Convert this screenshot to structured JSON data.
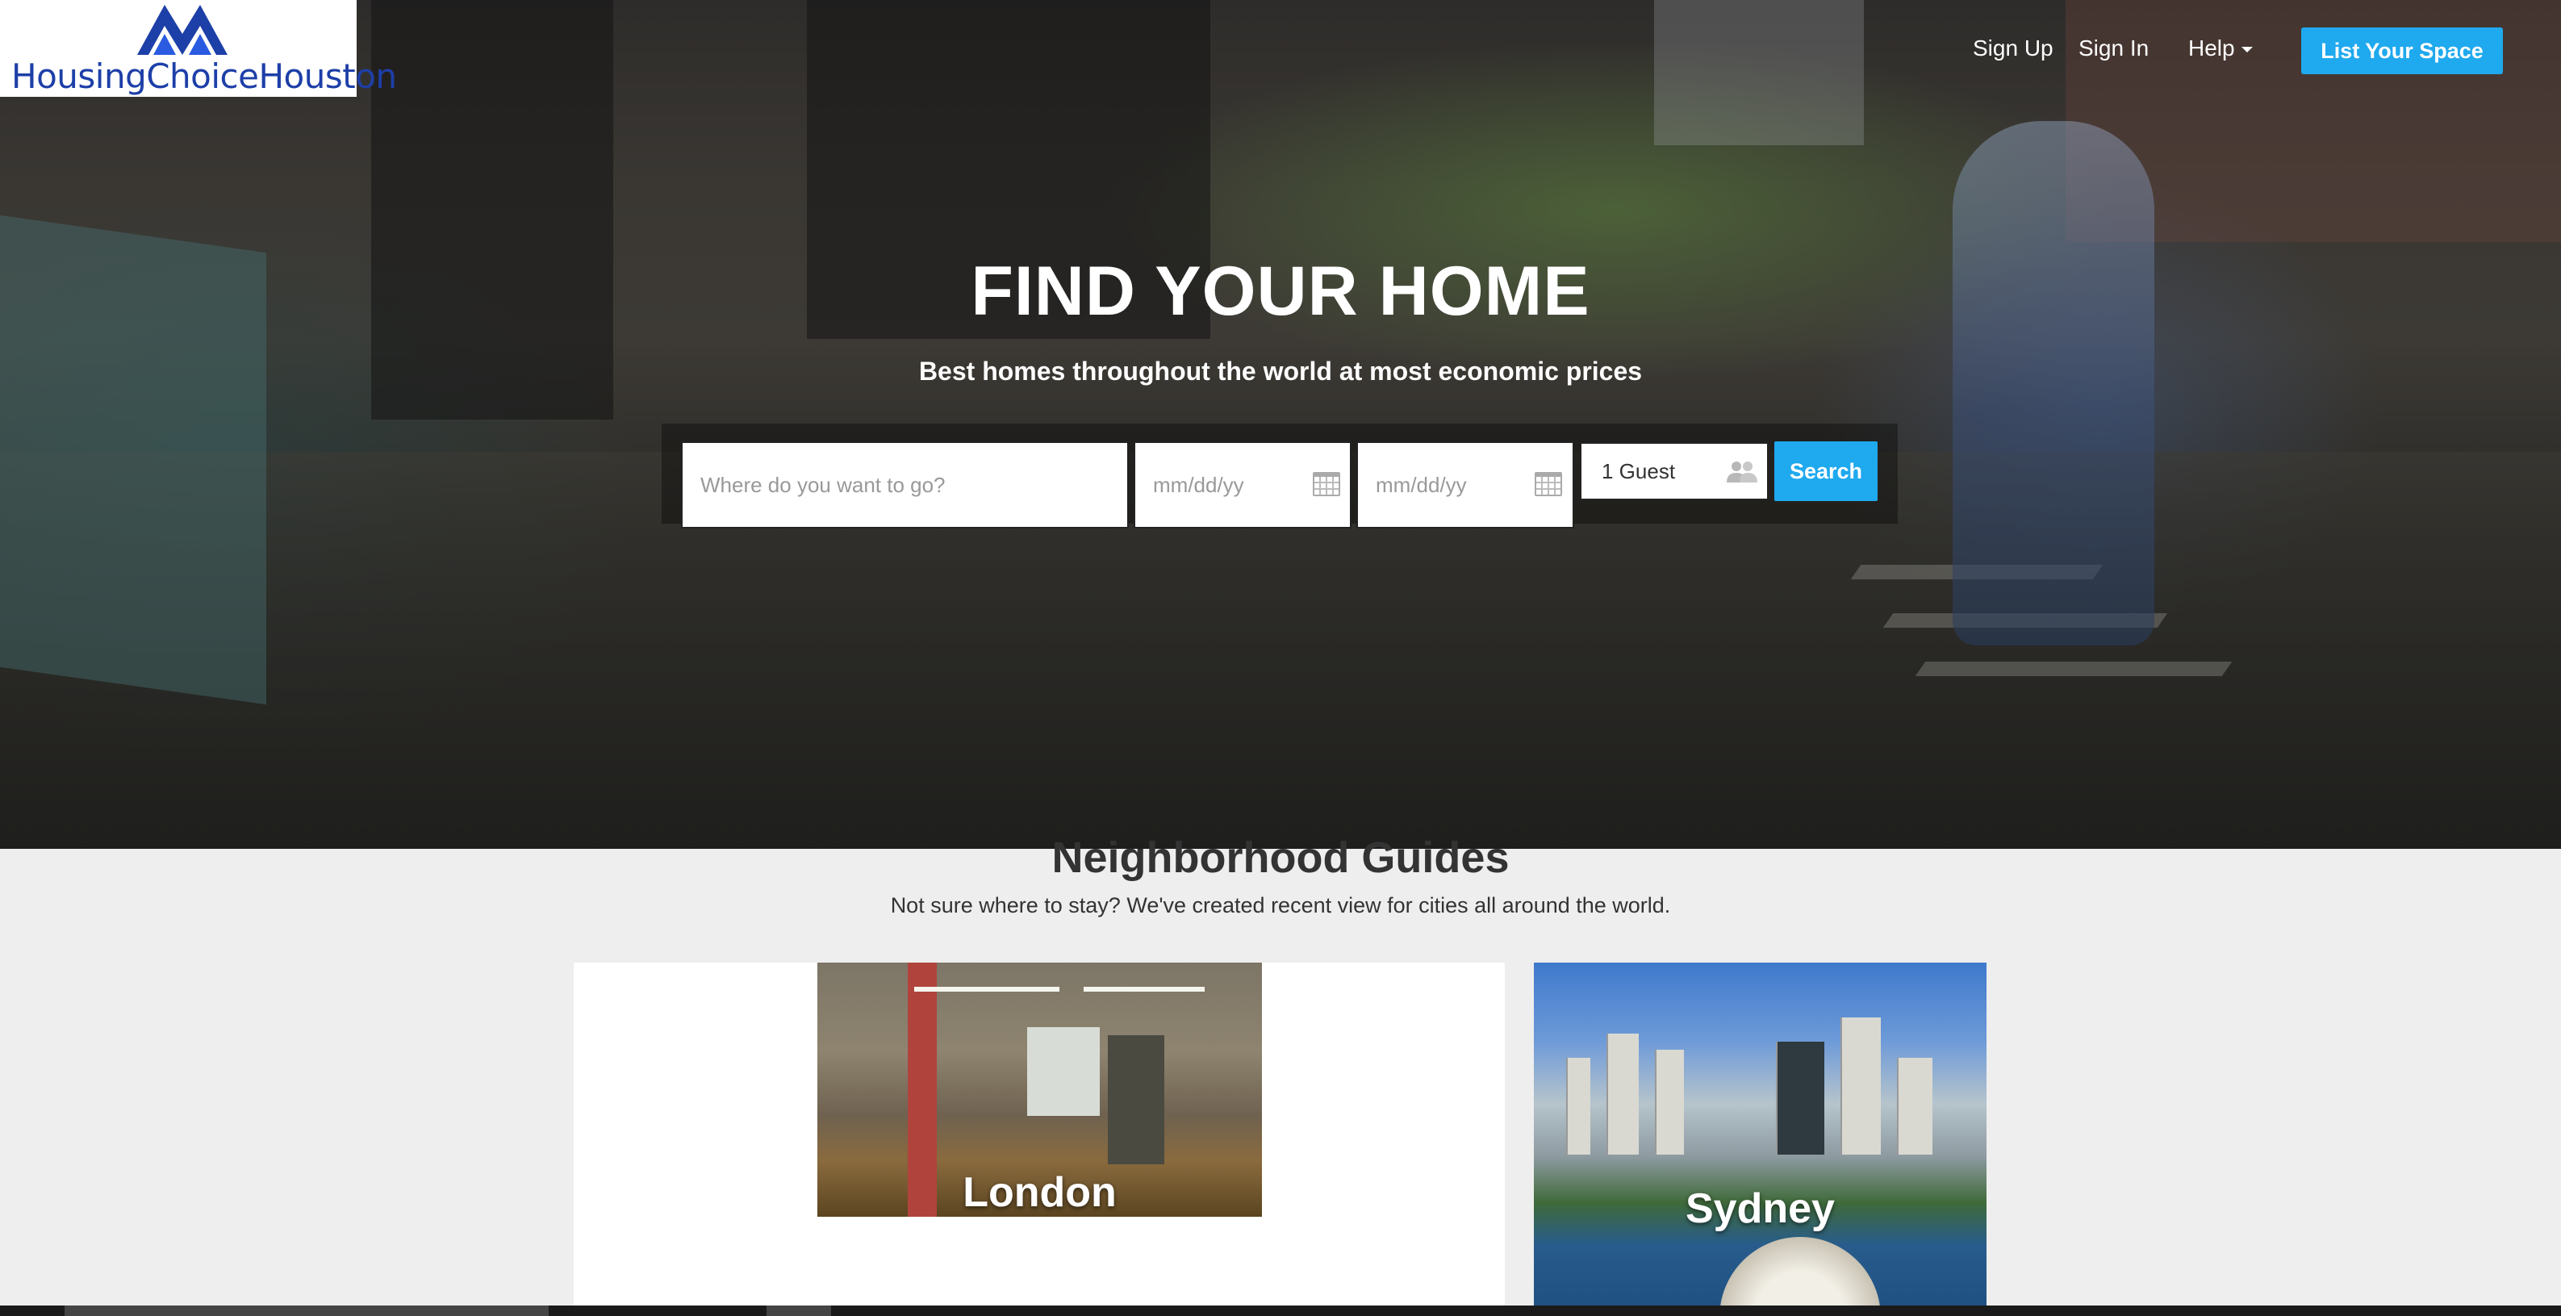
{
  "brand": {
    "name": "HousingChoiceHouston",
    "primary_color": "#1d3fa8",
    "accent_color": "#1fa9ee"
  },
  "nav": {
    "sign_up": "Sign Up",
    "sign_in": "Sign In",
    "help": "Help",
    "list_space": "List Your Space"
  },
  "hero": {
    "title": "FIND YOUR HOME",
    "subtitle": "Best homes throughout the world at most economic prices"
  },
  "search": {
    "where_placeholder": "Where do you want to go?",
    "checkin_placeholder": "mm/dd/yy",
    "checkout_placeholder": "mm/dd/yy",
    "guests_value": "1 Guest",
    "button_label": "Search",
    "calendar_icon": "calendar-icon",
    "guests_icon": "people-icon"
  },
  "neighborhood": {
    "title": "Neighborhood Guides",
    "subtitle": "Not sure where to stay? We've created recent view for cities all around the world.",
    "cities": [
      {
        "name": "London"
      },
      {
        "name": "Sydney"
      }
    ]
  }
}
